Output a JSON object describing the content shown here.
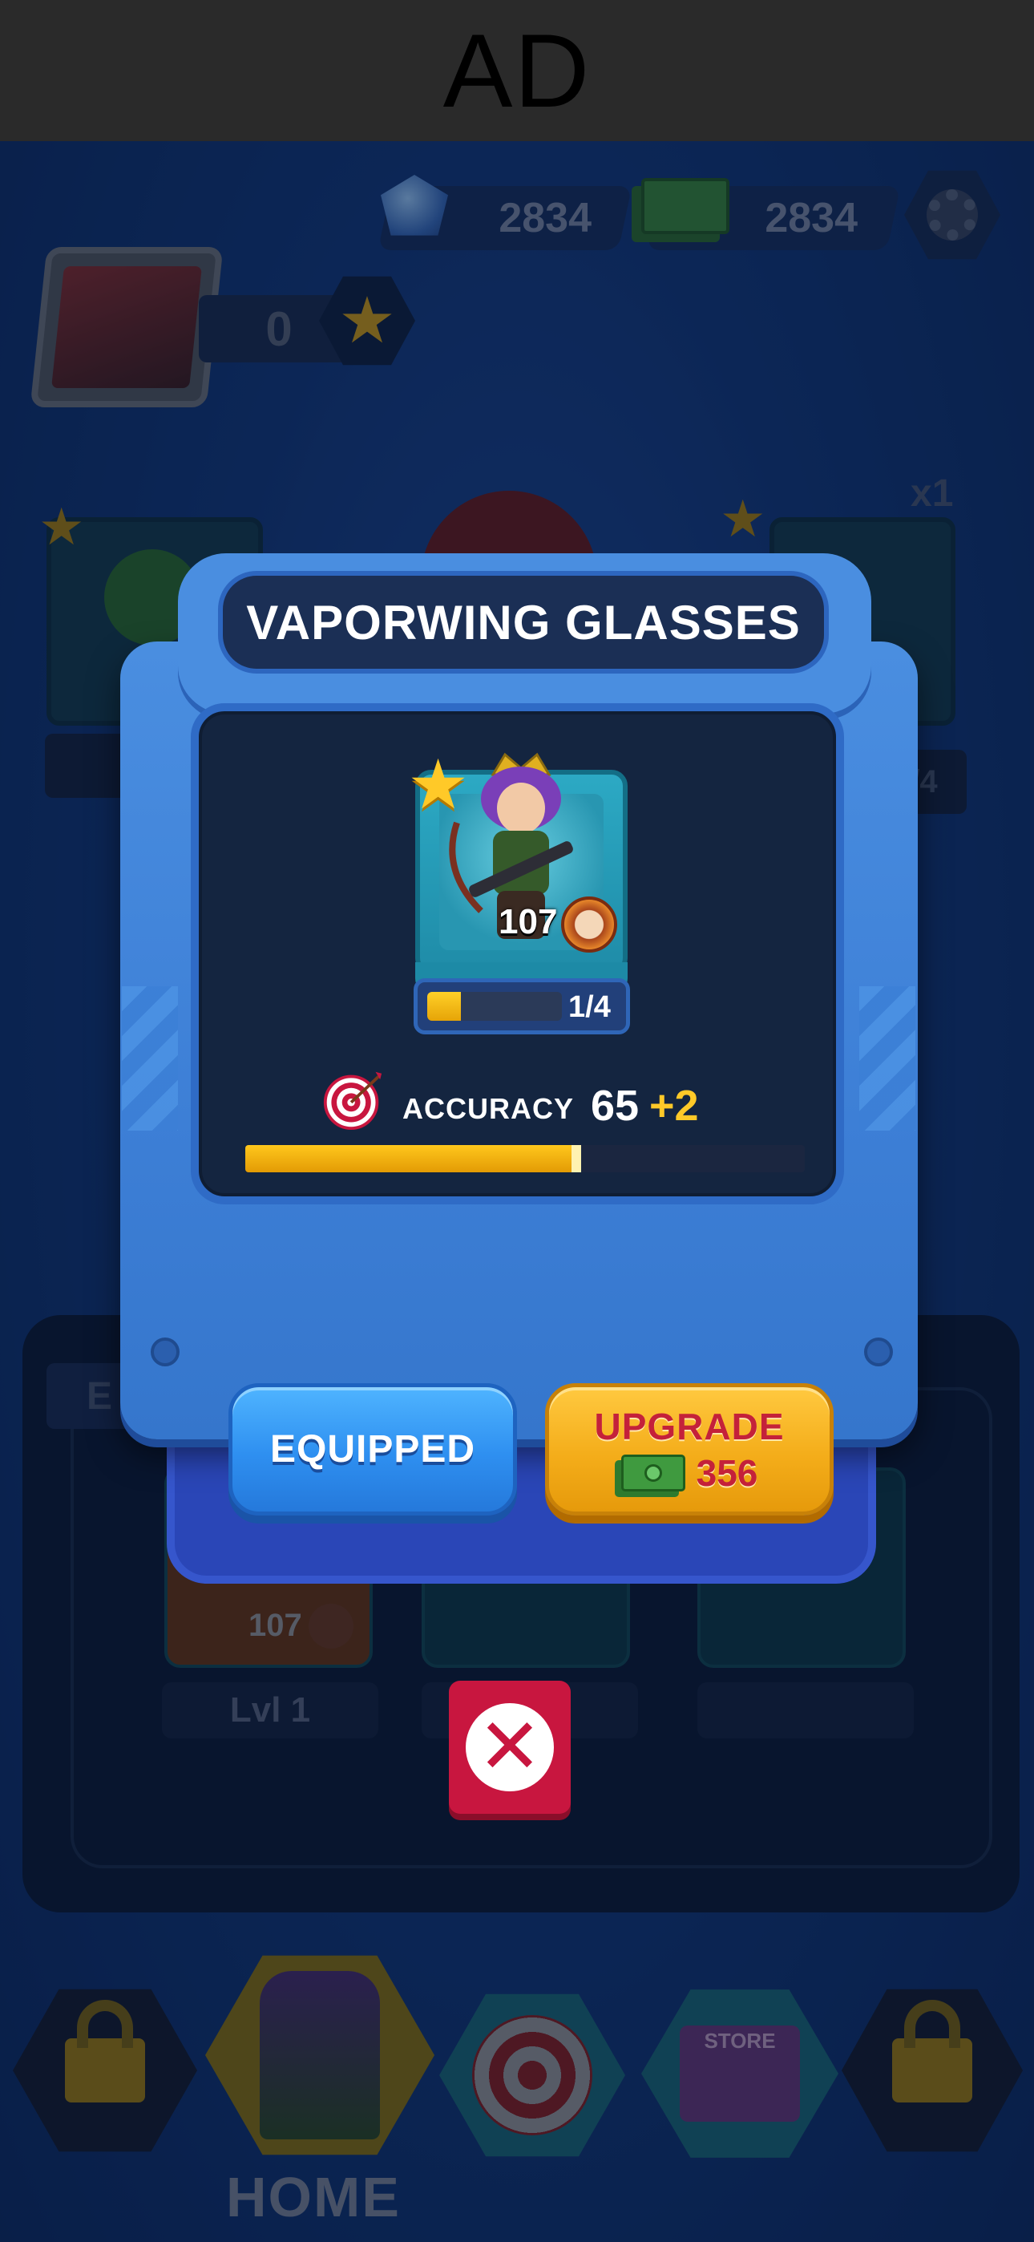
{
  "ad": {
    "label": "AD"
  },
  "hud": {
    "gems": "2834",
    "cash": "2834",
    "player_level": "0"
  },
  "background": {
    "right_card_multiplier": "x1",
    "right_card_progress": "/4",
    "left_card_label_fragment": "E",
    "slot_card_level": "107",
    "slot_label": "Lvl 1",
    "panel_tab_fragment": "E("
  },
  "modal": {
    "title": "VAPORWING GLASSES",
    "item": {
      "level": "107",
      "progress_text": "1/4",
      "progress_fraction": 0.25,
      "star_icon": "star-icon"
    },
    "stat": {
      "name": "ACCURACY",
      "value": "65",
      "bonus": "+2",
      "bar_fraction": 0.6
    },
    "buttons": {
      "equipped_label": "EQUIPPED",
      "upgrade_label": "UPGRADE",
      "upgrade_cost": "356"
    }
  },
  "nav": {
    "home_label": "HOME",
    "store_label": "STORE"
  },
  "colors": {
    "accent_blue": "#4a8ee0",
    "gold": "#ffc928",
    "close_red": "#c8163f"
  }
}
